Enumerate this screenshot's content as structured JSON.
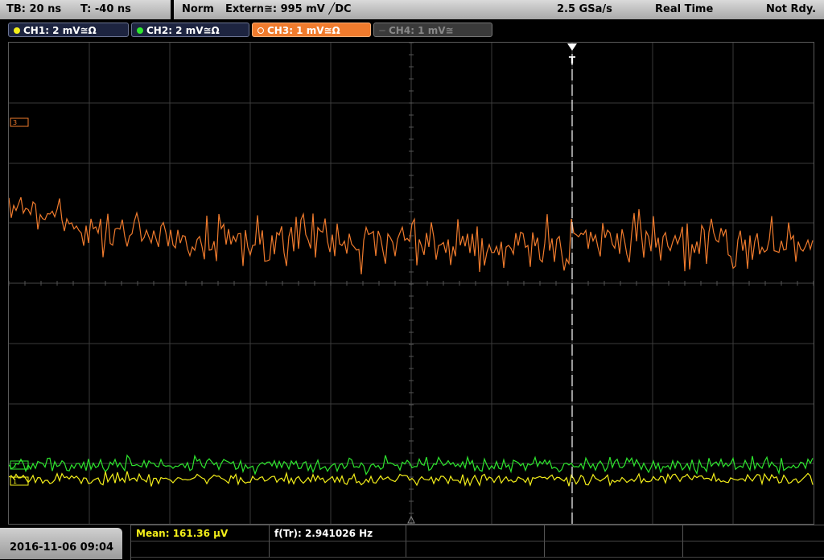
{
  "status": {
    "timebase": "TB: 20 ns",
    "trigger_offset": "T: -40 ns",
    "mode": "Norm",
    "source": "Extern≅: 995 mV ╱DC",
    "sample_rate": "2.5 GSa/s",
    "acq_mode": "Real Time",
    "state": "Not Rdy."
  },
  "channels": [
    {
      "label": "CH1: 2 mV≅Ω",
      "color": "#f4ef1a",
      "active": true
    },
    {
      "label": "CH2: 2 mV≅Ω",
      "color": "#2ee62e",
      "active": true
    },
    {
      "label": "CH3: 1 mV≅Ω",
      "color": "#f07b2d",
      "active": true,
      "selected": true
    },
    {
      "label": "CH4: 1 mV≅",
      "color": "#666666",
      "active": false
    }
  ],
  "trigger_marker": "T",
  "measurements": {
    "mean": "Mean: 161.36 µV",
    "freq": "f(Tr): 2.941026 Hz"
  },
  "datetime": "2016-11-06 09:04",
  "colors": {
    "ch1": "#f4ef1a",
    "ch2": "#2ee62e",
    "ch3": "#f07b2d",
    "grid": "#3a3a3a"
  }
}
